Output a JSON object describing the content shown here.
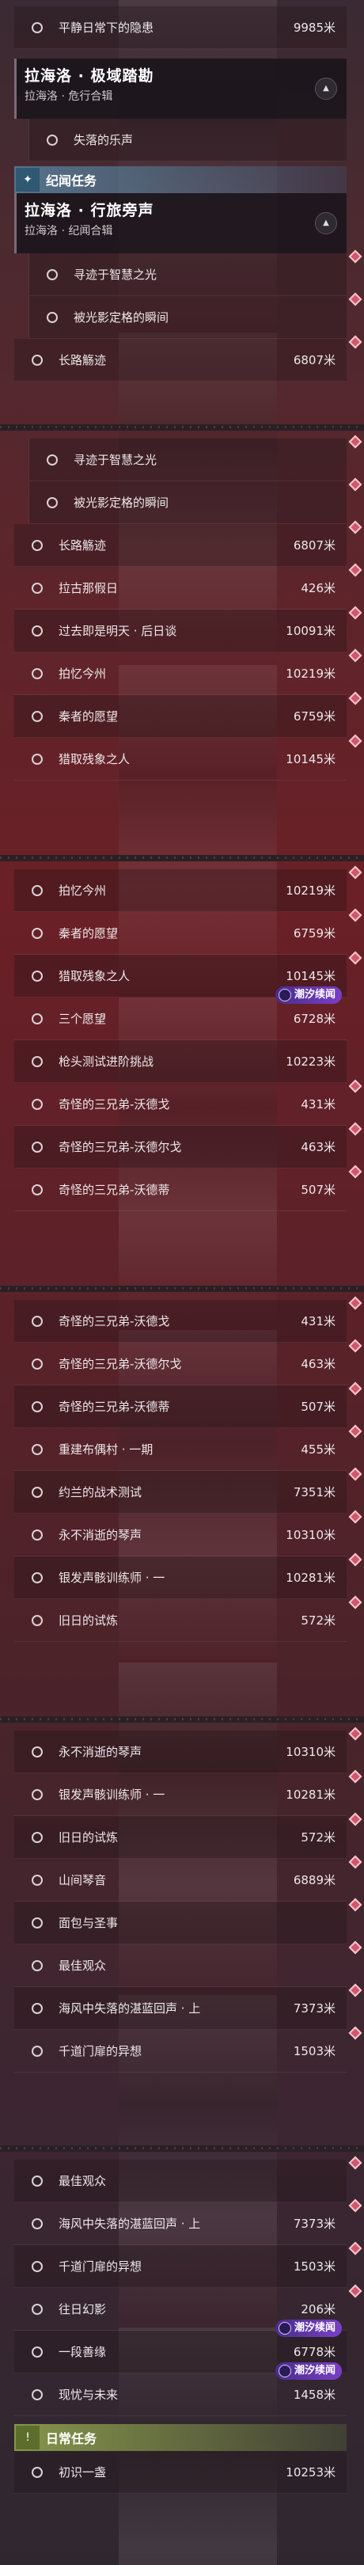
{
  "s1": {
    "rows": [
      {
        "label": "平静日常下的隐患",
        "distance": "9985米"
      }
    ],
    "group1": {
      "title": "拉海洛 · 极域踏勘",
      "subtitle": "拉海洛 · 危行合辑"
    },
    "rows2": [
      {
        "label": "失落的乐声",
        "distance": ""
      }
    ],
    "category": {
      "label": "纪闻任务",
      "icon": "sparkle-icon"
    },
    "group2": {
      "title": "拉海洛 · 行旅旁声",
      "subtitle": "拉海洛 · 纪闻合辑"
    },
    "rows3": [
      {
        "label": "寻迹于智慧之光",
        "distance": ""
      },
      {
        "label": "被光影定格的瞬间",
        "distance": ""
      }
    ],
    "rows4": [
      {
        "label": "长路觞迹",
        "distance": "6807米"
      }
    ]
  },
  "s2": {
    "rowsA": [
      {
        "label": "寻迹于智慧之光",
        "distance": ""
      },
      {
        "label": "被光影定格的瞬间",
        "distance": ""
      }
    ],
    "rowsB": [
      {
        "label": "长路觞迹",
        "distance": "6807米"
      },
      {
        "label": "拉古那假日",
        "distance": "426米"
      },
      {
        "label": "过去即是明天 · 后日谈",
        "distance": "10091米"
      },
      {
        "label": "拍忆今州",
        "distance": "10219米"
      },
      {
        "label": "秦者的愿望",
        "distance": "6759米"
      },
      {
        "label": "猎取残象之人",
        "distance": "10145米"
      }
    ]
  },
  "s3": {
    "rows": [
      {
        "label": "拍忆今州",
        "distance": "10219米"
      },
      {
        "label": "秦者的愿望",
        "distance": "6759米"
      },
      {
        "label": "猎取残象之人",
        "distance": "10145米"
      },
      {
        "label": "三个愿望",
        "distance": "6728米"
      },
      {
        "label": "枪头测试进阶挑战",
        "distance": "10223米"
      },
      {
        "label": "奇怪的三兄弟-沃德戈",
        "distance": "431米"
      },
      {
        "label": "奇怪的三兄弟-沃德尔戈",
        "distance": "463米"
      },
      {
        "label": "奇怪的三兄弟-沃德蒂",
        "distance": "507米"
      }
    ],
    "badge": "潮汐续闻"
  },
  "s4": {
    "rows": [
      {
        "label": "奇怪的三兄弟-沃德戈",
        "distance": "431米"
      },
      {
        "label": "奇怪的三兄弟-沃德尔戈",
        "distance": "463米"
      },
      {
        "label": "奇怪的三兄弟-沃德蒂",
        "distance": "507米"
      },
      {
        "label": "重建布偶村 · 一期",
        "distance": "455米"
      },
      {
        "label": "约兰的战术测试",
        "distance": "7351米"
      },
      {
        "label": "永不消逝的琴声",
        "distance": "10310米"
      },
      {
        "label": "银发声骸训练师 · 一",
        "distance": "10281米"
      },
      {
        "label": "旧日的试炼",
        "distance": "572米"
      }
    ]
  },
  "s5": {
    "rows": [
      {
        "label": "永不消逝的琴声",
        "distance": "10310米"
      },
      {
        "label": "银发声骸训练师 · 一",
        "distance": "10281米"
      },
      {
        "label": "旧日的试炼",
        "distance": "572米"
      },
      {
        "label": "山间琴音",
        "distance": "6889米"
      },
      {
        "label": "面包与圣事",
        "distance": ""
      },
      {
        "label": "最佳观众",
        "distance": ""
      },
      {
        "label": "海风中失落的湛蓝回声 · 上",
        "distance": "7373米"
      },
      {
        "label": "千道门扉的异想",
        "distance": "1503米"
      }
    ]
  },
  "s6": {
    "rows": [
      {
        "label": "最佳观众",
        "distance": ""
      },
      {
        "label": "海风中失落的湛蓝回声 · 上",
        "distance": "7373米"
      },
      {
        "label": "千道门扉的异想",
        "distance": "1503米"
      },
      {
        "label": "往日幻影",
        "distance": "206米"
      },
      {
        "label": "一段善缘",
        "distance": "6778米"
      },
      {
        "label": "现忧与未来",
        "distance": "1458米"
      }
    ],
    "badge": "潮汐续闻",
    "category": {
      "label": "日常任务",
      "icon": "daily-quest-icon"
    },
    "rows2": [
      {
        "label": "初识一盏",
        "distance": "10253米"
      }
    ]
  }
}
